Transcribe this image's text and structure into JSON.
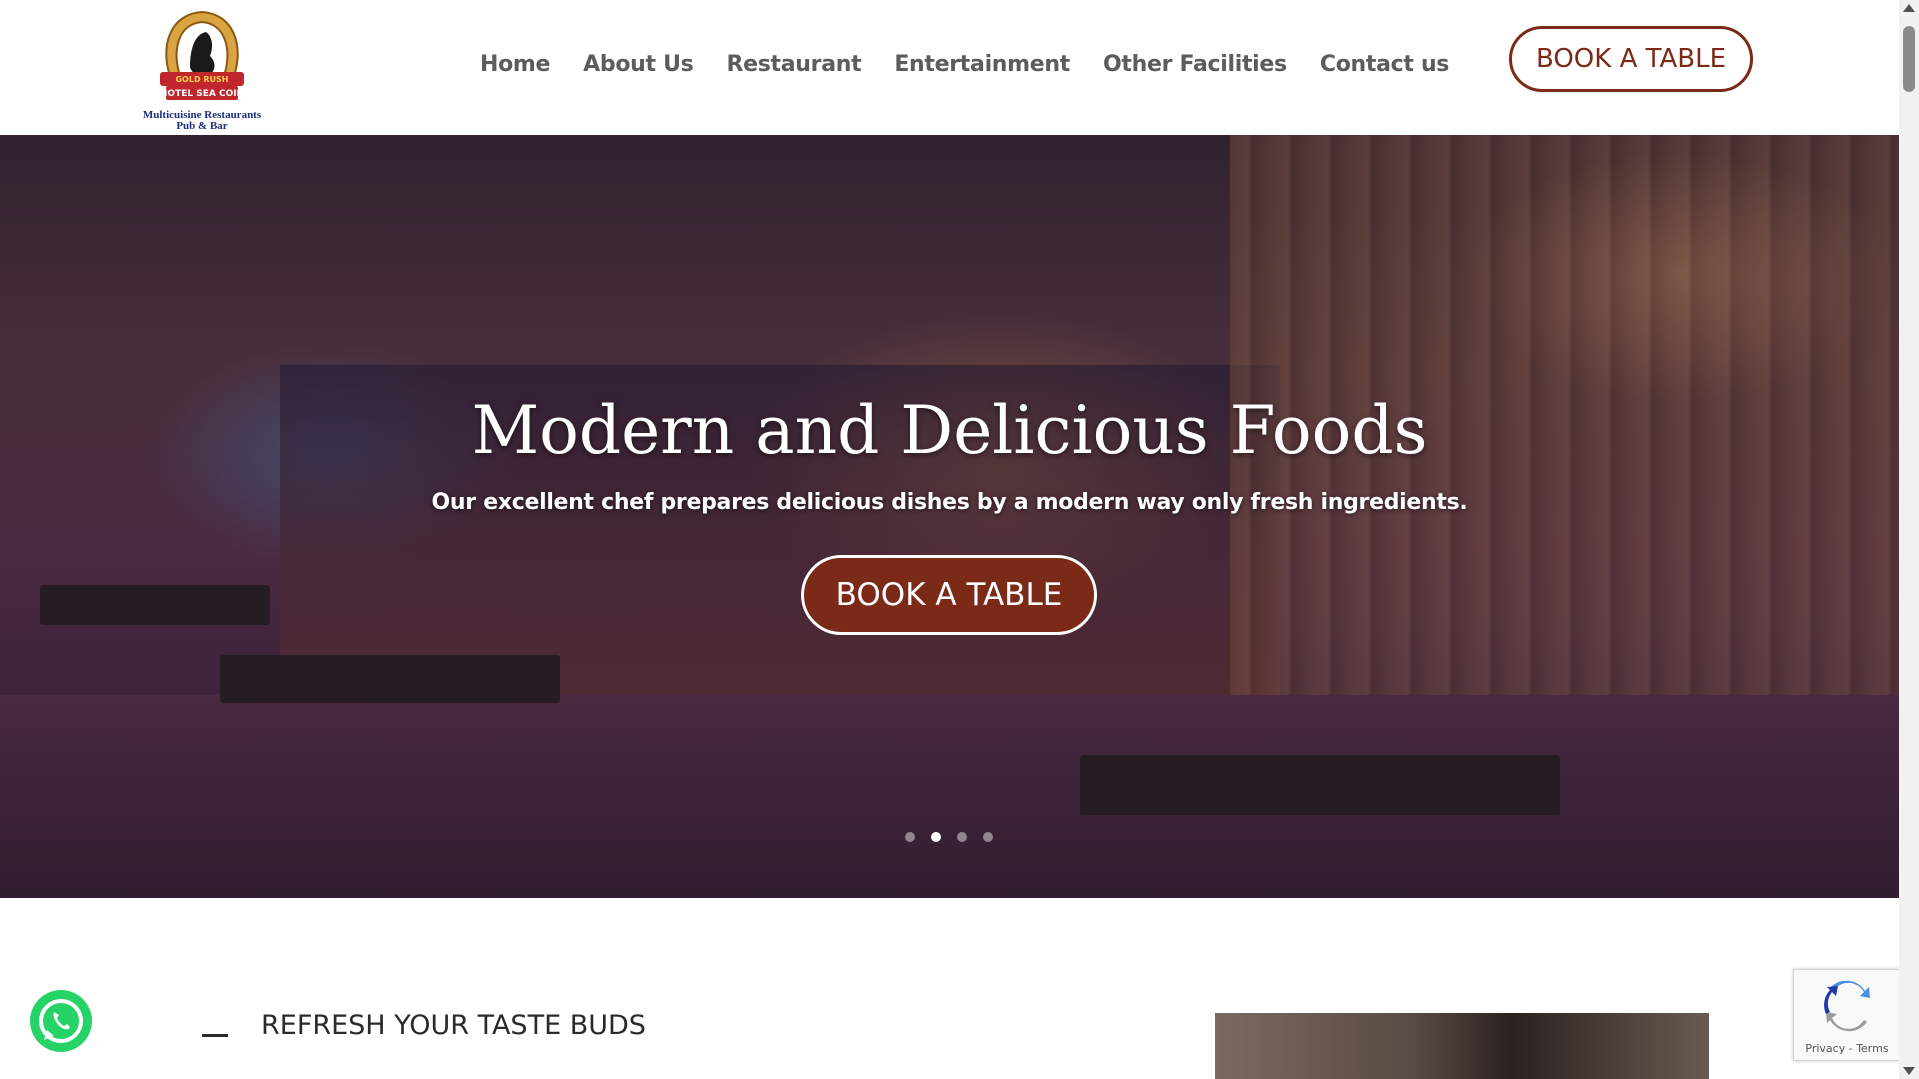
{
  "logo": {
    "tagline_line1": "Multicuisine Restaurants",
    "tagline_line2": "Pub & Bar"
  },
  "nav": {
    "items": [
      {
        "label": "Home"
      },
      {
        "label": "About Us"
      },
      {
        "label": "Restaurant"
      },
      {
        "label": "Entertainment"
      },
      {
        "label": "Other Facilities"
      },
      {
        "label": "Contact us"
      }
    ],
    "book_label": "BOOK A TABLE"
  },
  "hero": {
    "title": "Modern and Delicious Foods",
    "subtitle": "Our excellent chef prepares delicious dishes by a modern way only fresh ingredients.",
    "book_label": "BOOK A TABLE",
    "slide_count": 4,
    "active_slide": 2
  },
  "section": {
    "heading": "REFRESH YOUR TASTE BUDS"
  },
  "recaptcha": {
    "privacy": "Privacy",
    "separator": " - ",
    "terms": "Terms"
  },
  "colors": {
    "brand": "#7a2a17",
    "nav_text": "#5c5c5c",
    "whatsapp": "#25d366"
  },
  "icons": {
    "whatsapp": "whatsapp-icon",
    "recaptcha": "recaptcha-icon",
    "logo": "horse-horseshoe-logo"
  }
}
